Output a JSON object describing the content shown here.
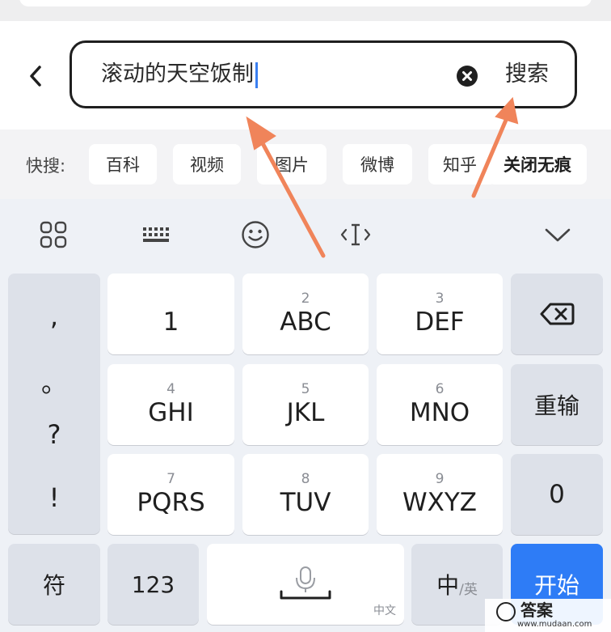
{
  "search": {
    "query": "滚动的天空饭制",
    "search_label": "搜索"
  },
  "quick_search": {
    "label": "快搜:",
    "chips": [
      "百科",
      "视频",
      "图片",
      "微博",
      "知乎"
    ],
    "close_traceless": "关闭无痕"
  },
  "keyboard": {
    "punctuation": [
      ",",
      "。",
      "?",
      "!"
    ],
    "keys": [
      {
        "num": "",
        "letters": "1"
      },
      {
        "num": "2",
        "letters": "ABC"
      },
      {
        "num": "3",
        "letters": "DEF"
      },
      {
        "num": "4",
        "letters": "GHI"
      },
      {
        "num": "5",
        "letters": "JKL"
      },
      {
        "num": "6",
        "letters": "MNO"
      },
      {
        "num": "7",
        "letters": "PQRS"
      },
      {
        "num": "8",
        "letters": "TUV"
      },
      {
        "num": "9",
        "letters": "WXYZ"
      }
    ],
    "reenter": "重输",
    "zero": "0",
    "symbols": "符",
    "numbers": "123",
    "space_sub": "中文",
    "lang_main": "中",
    "lang_sub": "/英",
    "start": "开始"
  },
  "watermark": {
    "text": "答案",
    "url": "www.mudaan.com"
  },
  "colors": {
    "accent_blue": "#2e7cf6",
    "arrow_orange": "#f0845a",
    "caret_blue": "#3a7ff0"
  }
}
